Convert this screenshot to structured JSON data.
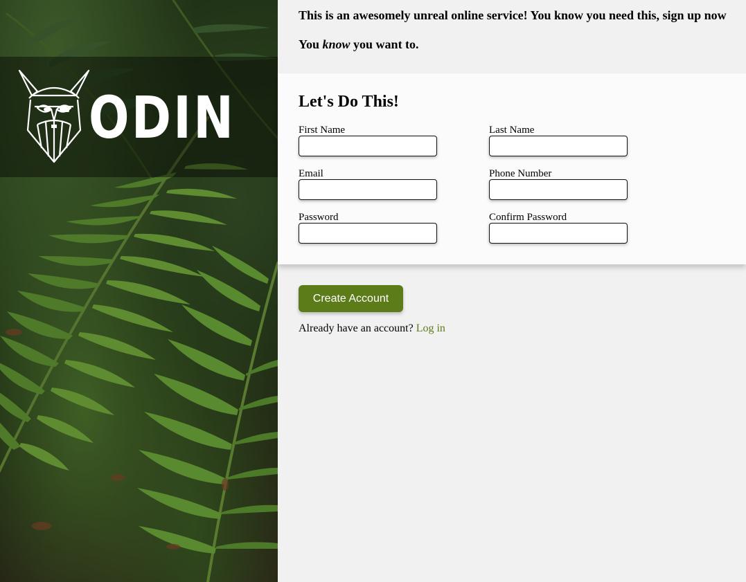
{
  "brand": {
    "logo_text": "ODIN",
    "logo_icon": "viking-helmet-icon"
  },
  "intro": {
    "line1": "This is an awesomely unreal online service! You know you need this, sign up now",
    "line2_before": "You ",
    "line2_emphasis": "know",
    "line2_after": " you want to."
  },
  "form": {
    "heading": "Let's Do This!",
    "fields": {
      "first_name": {
        "label": "First Name",
        "value": ""
      },
      "last_name": {
        "label": "Last Name",
        "value": ""
      },
      "email": {
        "label": "Email",
        "value": ""
      },
      "phone": {
        "label": "Phone Number",
        "value": ""
      },
      "password": {
        "label": "Password",
        "value": ""
      },
      "confirm_password": {
        "label": "Confirm Password",
        "value": ""
      }
    }
  },
  "actions": {
    "create_account_label": "Create Account",
    "login_prompt": "Already have an account? ",
    "login_link": "Log in"
  },
  "colors": {
    "accent": "#5c7c1a",
    "page_background": "#f1f1f1",
    "card_background": "#fbfbfb"
  }
}
